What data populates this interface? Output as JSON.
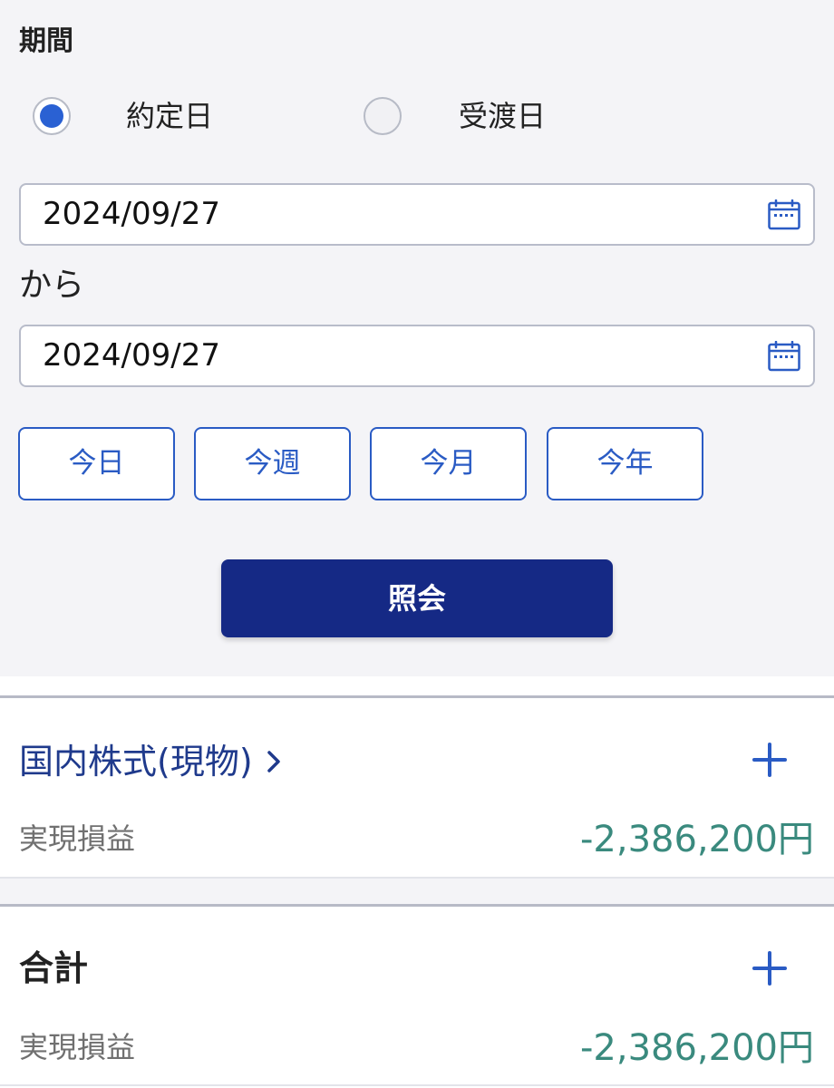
{
  "period": {
    "label": "期間",
    "options": [
      {
        "label": "約定日",
        "selected": true
      },
      {
        "label": "受渡日",
        "selected": false
      }
    ],
    "from_date": "2024/09/27",
    "separator": "から",
    "to_date": "2024/09/27",
    "quick_ranges": [
      "今日",
      "今週",
      "今月",
      "今年"
    ],
    "submit_label": "照会"
  },
  "sections": [
    {
      "title": "国内株式(現物)",
      "has_link": true,
      "row_label": "実現損益",
      "row_value": "-2,386,200円"
    },
    {
      "title": "合計",
      "has_link": false,
      "row_label": "実現損益",
      "row_value": "-2,386,200円"
    }
  ],
  "icons": {
    "calendar": "calendar-icon",
    "chevron": "chevron-right-icon",
    "expand": "plus-icon"
  },
  "colors": {
    "accent": "#2a61d3",
    "primary_button": "#152985",
    "link": "#1f3a8c",
    "loss_value": "#3a8a7e",
    "panel_bg": "#f4f4f7"
  }
}
